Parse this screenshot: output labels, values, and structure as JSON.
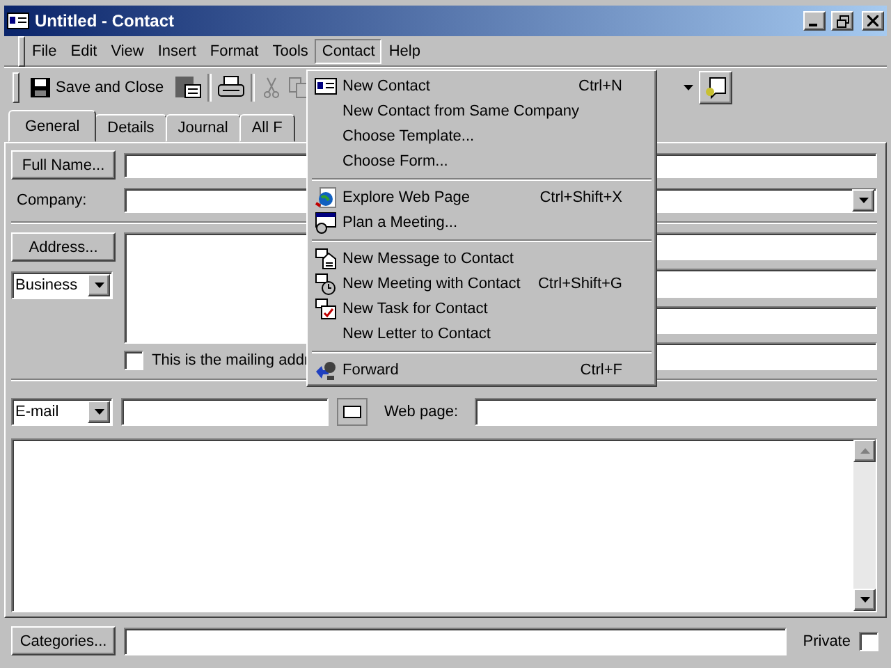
{
  "window": {
    "title": "Untitled - Contact"
  },
  "menu_bar": [
    {
      "label": "File",
      "selected": false
    },
    {
      "label": "Edit",
      "selected": false
    },
    {
      "label": "View",
      "selected": false
    },
    {
      "label": "Insert",
      "selected": false
    },
    {
      "label": "Format",
      "selected": false
    },
    {
      "label": "Tools",
      "selected": false
    },
    {
      "label": "Contact",
      "selected": true
    },
    {
      "label": "Help",
      "selected": false
    }
  ],
  "toolbar": {
    "save_close": "Save and Close"
  },
  "tabs": [
    {
      "label": "General",
      "selected": true
    },
    {
      "label": "Details",
      "selected": false
    },
    {
      "label": "Journal",
      "selected": false
    },
    {
      "label": "All F",
      "selected": false
    }
  ],
  "form": {
    "full_name_button": "Full Name...",
    "company_label": "Company:",
    "address_button": "Address...",
    "address_type": "Business",
    "mailing_checkbox": {
      "label": "This is the mailing addr",
      "checked": false
    },
    "email_type": "E-mail",
    "web_page_label": "Web page:",
    "categories_button": "Categories...",
    "private": {
      "label": "Private",
      "checked": false
    }
  },
  "contact_menu": [
    {
      "kind": "item",
      "label": "New Contact",
      "shortcut": "Ctrl+N"
    },
    {
      "kind": "item",
      "label": "New Contact from Same Company"
    },
    {
      "kind": "item",
      "label": "Choose Template..."
    },
    {
      "kind": "item",
      "label": "Choose Form..."
    },
    {
      "kind": "separator"
    },
    {
      "kind": "item",
      "label": "Explore Web Page",
      "shortcut": "Ctrl+Shift+X"
    },
    {
      "kind": "item",
      "label": "Plan a Meeting..."
    },
    {
      "kind": "separator"
    },
    {
      "kind": "item",
      "label": "New Message to Contact"
    },
    {
      "kind": "item",
      "label": "New Meeting with Contact",
      "shortcut": "Ctrl+Shift+G"
    },
    {
      "kind": "item",
      "label": "New Task for Contact"
    },
    {
      "kind": "item",
      "label": "New Letter to Contact"
    },
    {
      "kind": "separator"
    },
    {
      "kind": "item",
      "label": "Forward",
      "shortcut": "Ctrl+F"
    }
  ]
}
